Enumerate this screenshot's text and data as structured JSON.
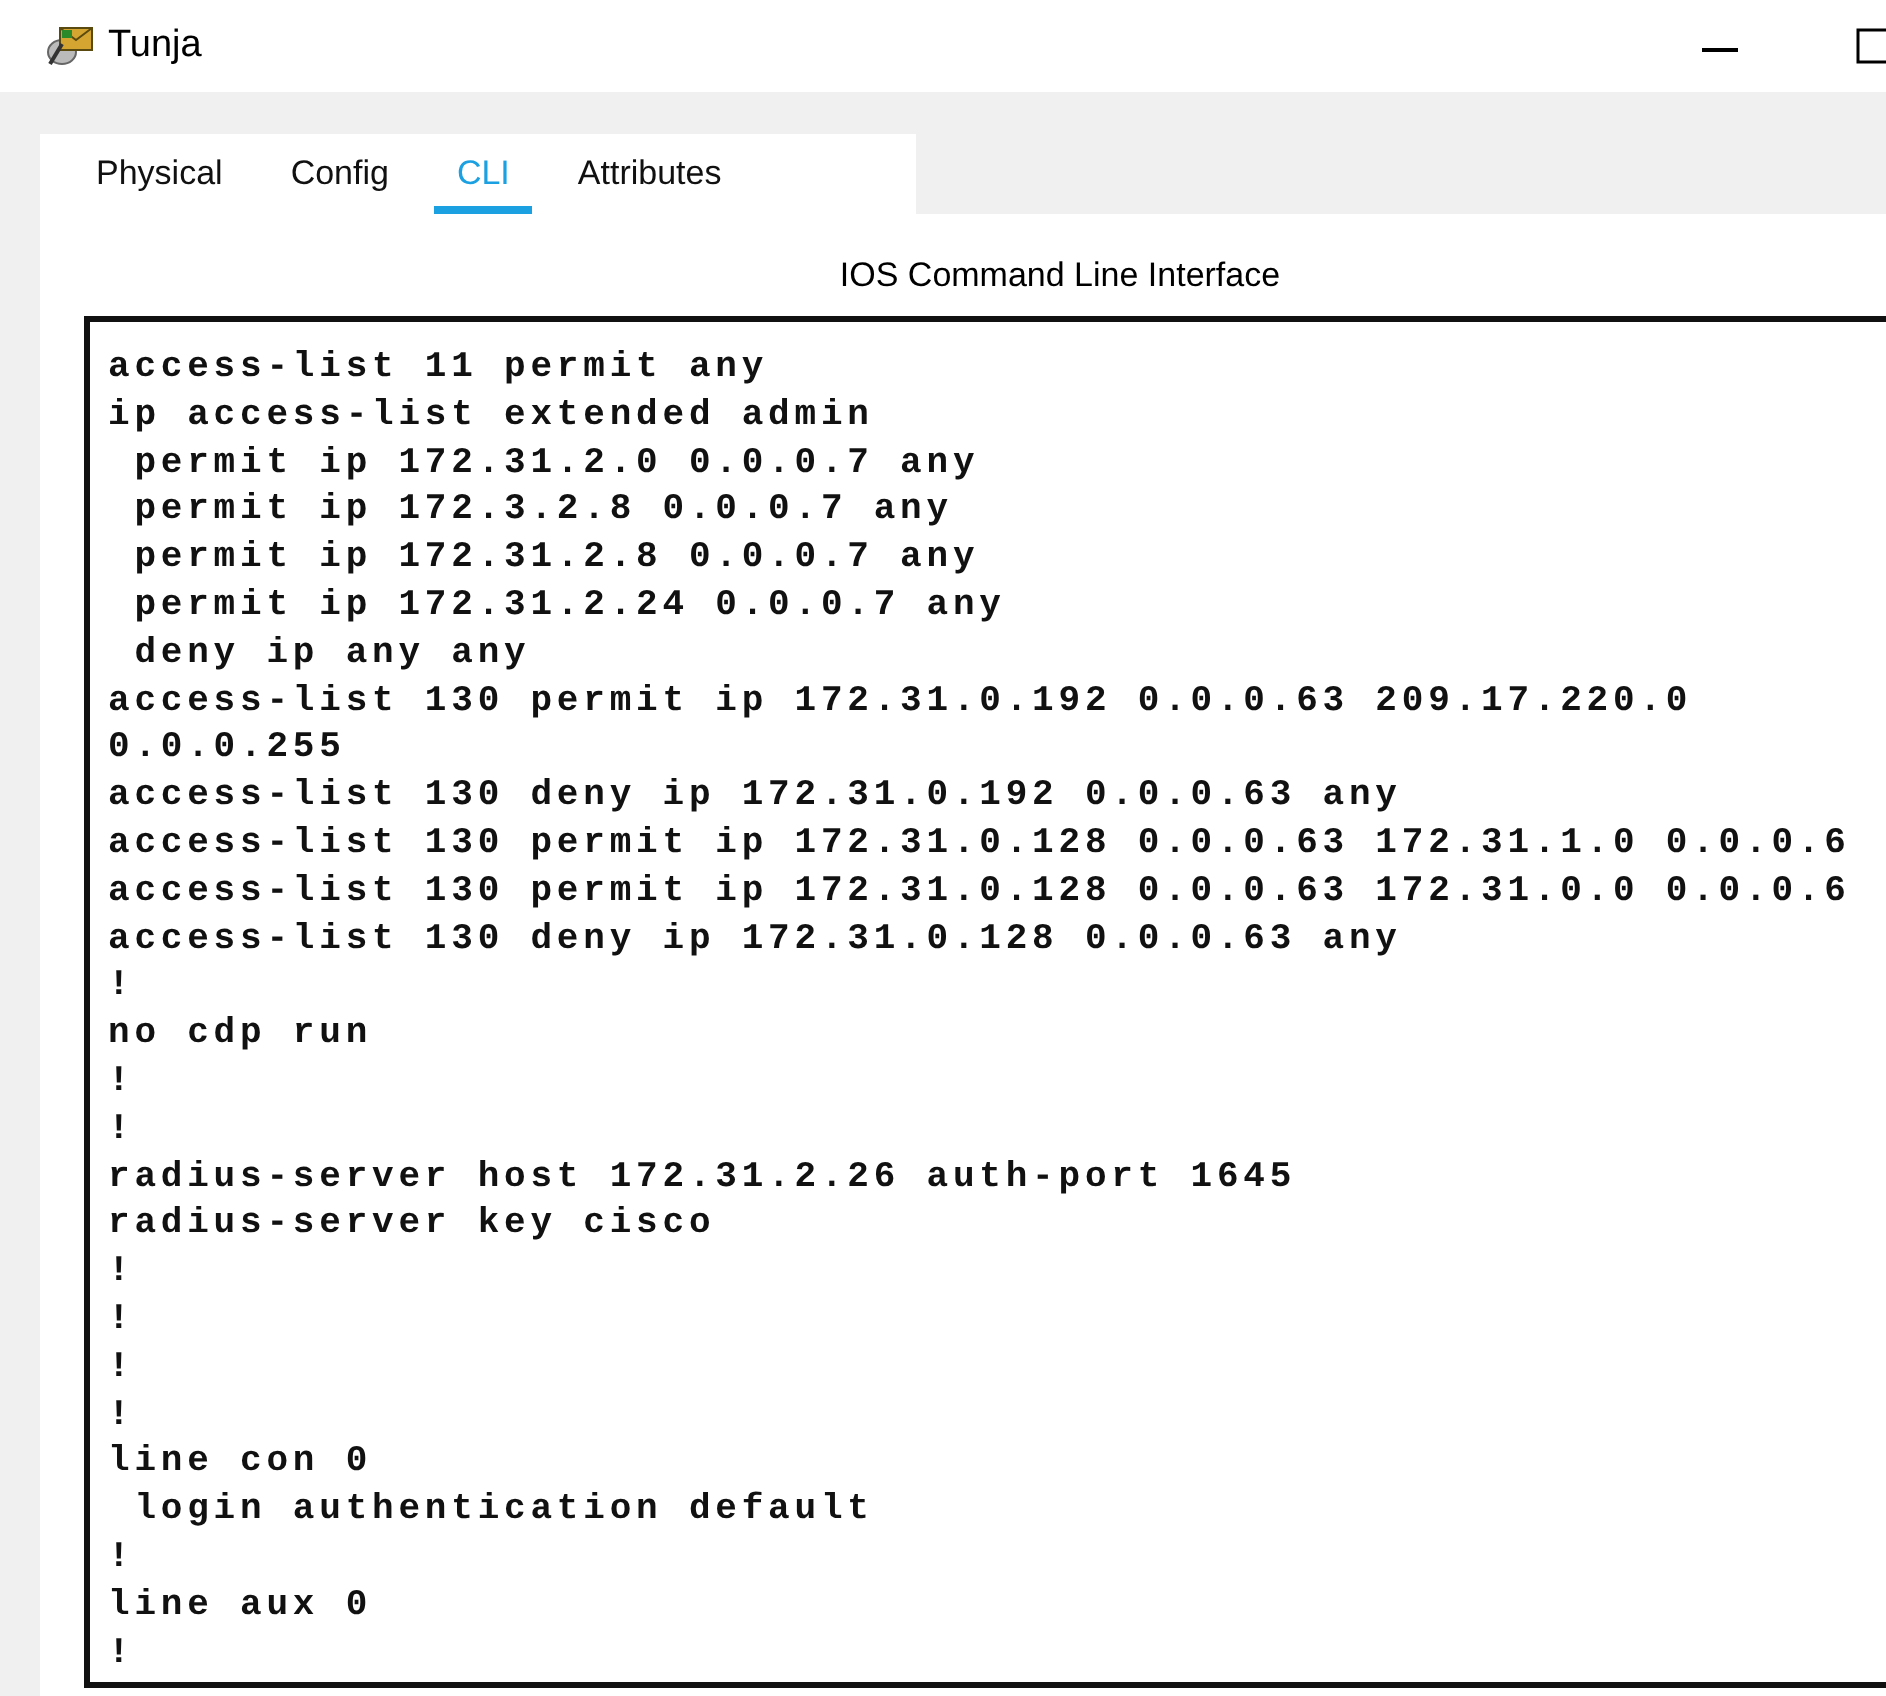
{
  "window": {
    "title": "Tunja"
  },
  "tabs": [
    {
      "label": "Physical",
      "selected": false
    },
    {
      "label": "Config",
      "selected": false
    },
    {
      "label": "CLI",
      "selected": true
    },
    {
      "label": "Attributes",
      "selected": false
    }
  ],
  "cli": {
    "heading": "IOS Command Line Interface",
    "lines": [
      "access-list 11 permit any",
      "ip access-list extended admin",
      " permit ip 172.31.2.0 0.0.0.7 any",
      " permit ip 172.3.2.8 0.0.0.7 any",
      " permit ip 172.31.2.8 0.0.0.7 any",
      " permit ip 172.31.2.24 0.0.0.7 any",
      " deny ip any any",
      "access-list 130 permit ip 172.31.0.192 0.0.0.63 209.17.220.0",
      "0.0.0.255",
      "access-list 130 deny ip 172.31.0.192 0.0.0.63 any",
      "access-list 130 permit ip 172.31.0.128 0.0.0.63 172.31.1.0 0.0.0.6",
      "access-list 130 permit ip 172.31.0.128 0.0.0.63 172.31.0.0 0.0.0.6",
      "access-list 130 deny ip 172.31.0.128 0.0.0.63 any",
      "!",
      "no cdp run",
      "!",
      "!",
      "radius-server host 172.31.2.26 auth-port 1645",
      "radius-server key cisco",
      "!",
      "!",
      "!",
      "!",
      "line con 0",
      " login authentication default",
      "!",
      "line aux 0",
      "!"
    ]
  }
}
